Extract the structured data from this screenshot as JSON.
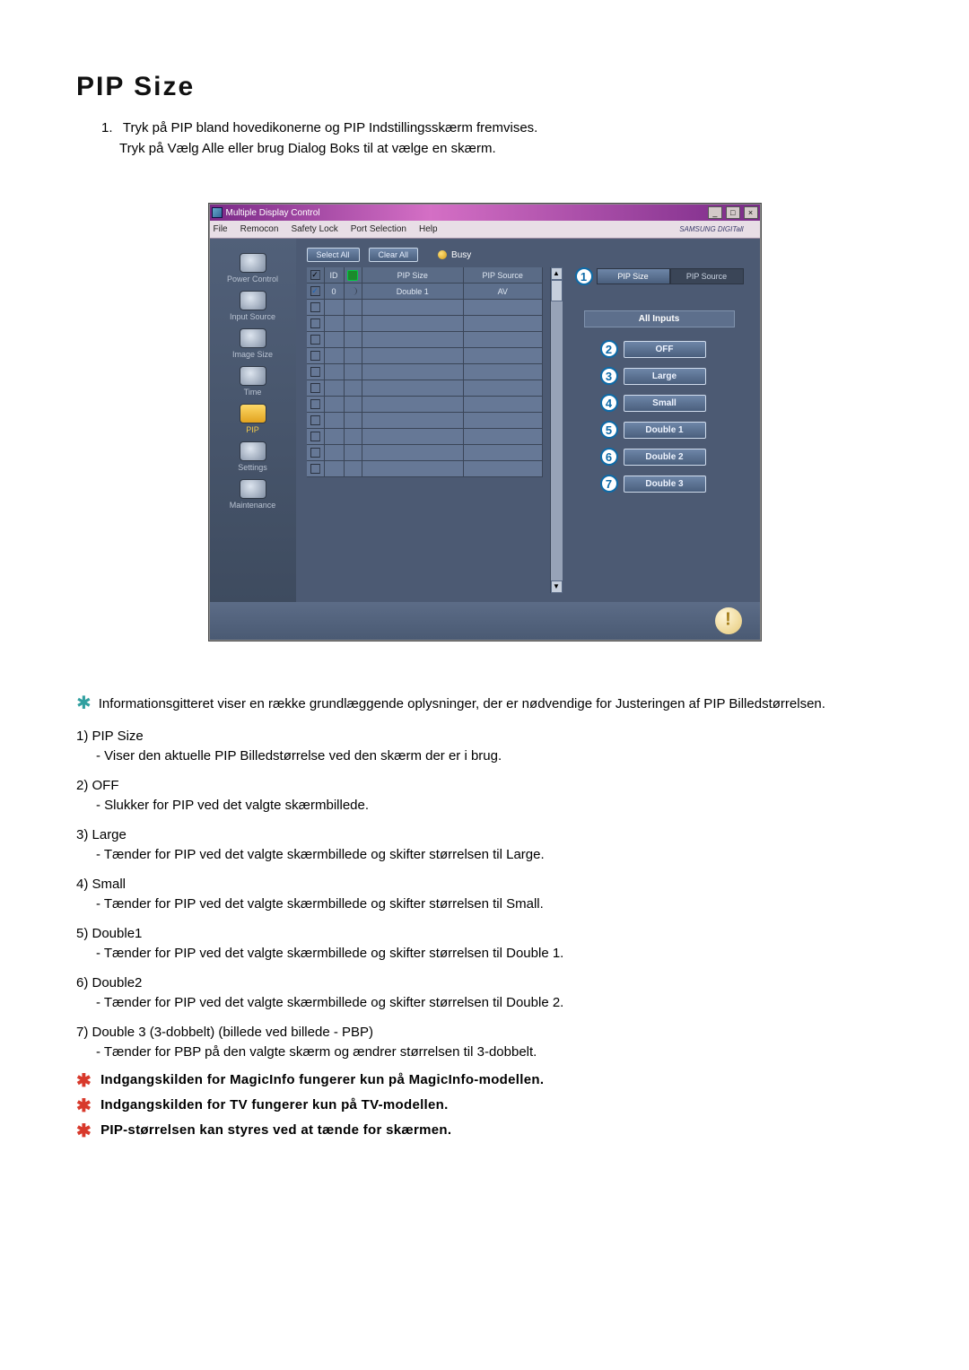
{
  "page": {
    "heading": "PIP Size",
    "intro_num": "1.",
    "intro_line1": "Tryk på PIP bland hovedikonerne og PIP Indstillingsskærm fremvises.",
    "intro_line2": "Tryk på Vælg Alle eller brug Dialog Boks til at vælge en skærm."
  },
  "window": {
    "title": "Multiple Display Control",
    "menu": {
      "file": "File",
      "remocon": "Remocon",
      "safety": "Safety Lock",
      "port": "Port Selection",
      "help": "Help"
    },
    "brand": "SAMSUNG DIGITall"
  },
  "sidebar": {
    "items": [
      {
        "label": "Power Control"
      },
      {
        "label": "Input Source"
      },
      {
        "label": "Image Size"
      },
      {
        "label": "Time"
      },
      {
        "label": "PIP"
      },
      {
        "label": "Settings"
      },
      {
        "label": "Maintenance"
      }
    ]
  },
  "toolbar": {
    "select_all": "Select All",
    "clear_all": "Clear All",
    "busy": "Busy"
  },
  "grid": {
    "head": {
      "id": "ID",
      "size": "PIP Size",
      "source": "PIP Source"
    },
    "row0": {
      "id": "0",
      "size": "Double 1",
      "source": "AV"
    }
  },
  "right": {
    "tab_active": "PIP Size",
    "tab_inactive": "PIP Source",
    "all_inputs": "All Inputs",
    "options": [
      {
        "n": "2",
        "label": "OFF"
      },
      {
        "n": "3",
        "label": "Large"
      },
      {
        "n": "4",
        "label": "Small"
      },
      {
        "n": "5",
        "label": "Double 1"
      },
      {
        "n": "6",
        "label": "Double 2"
      },
      {
        "n": "7",
        "label": "Double 3"
      }
    ],
    "callout1": "1"
  },
  "notes": {
    "info": "Informationsgitteret viser en række grundlæggende oplysninger, der er nødvendige for Justeringen af PIP Billedstørrelsen.",
    "items": [
      {
        "lbl": "1)  PIP Size",
        "desc": "- Viser den aktuelle PIP Billedstørrelse ved den skærm der er i brug."
      },
      {
        "lbl": "2)  OFF",
        "desc": "- Slukker for PIP ved det valgte skærmbillede."
      },
      {
        "lbl": "3)  Large",
        "desc": "- Tænder for PIP ved det valgte skærmbillede og skifter størrelsen til Large."
      },
      {
        "lbl": "4)  Small",
        "desc": "- Tænder for PIP ved det valgte skærmbillede og skifter størrelsen til Small."
      },
      {
        "lbl": "5)  Double1",
        "desc": "- Tænder for PIP ved det valgte skærmbillede og skifter størrelsen til Double 1."
      },
      {
        "lbl": "6)  Double2",
        "desc": "- Tænder for PIP ved det valgte skærmbillede og skifter størrelsen til Double 2."
      },
      {
        "lbl": "7)  Double 3 (3-dobbelt) (billede ved billede - PBP)",
        "desc": "- Tænder for PBP på den valgte skærm og ændrer størrelsen til 3-dobbelt."
      }
    ],
    "bold": [
      "Indgangskilden for MagicInfo fungerer kun på MagicInfo-modellen.",
      "Indgangskilden for TV fungerer kun på TV-modellen.",
      "PIP-størrelsen kan styres ved at tænde for skærmen."
    ]
  }
}
